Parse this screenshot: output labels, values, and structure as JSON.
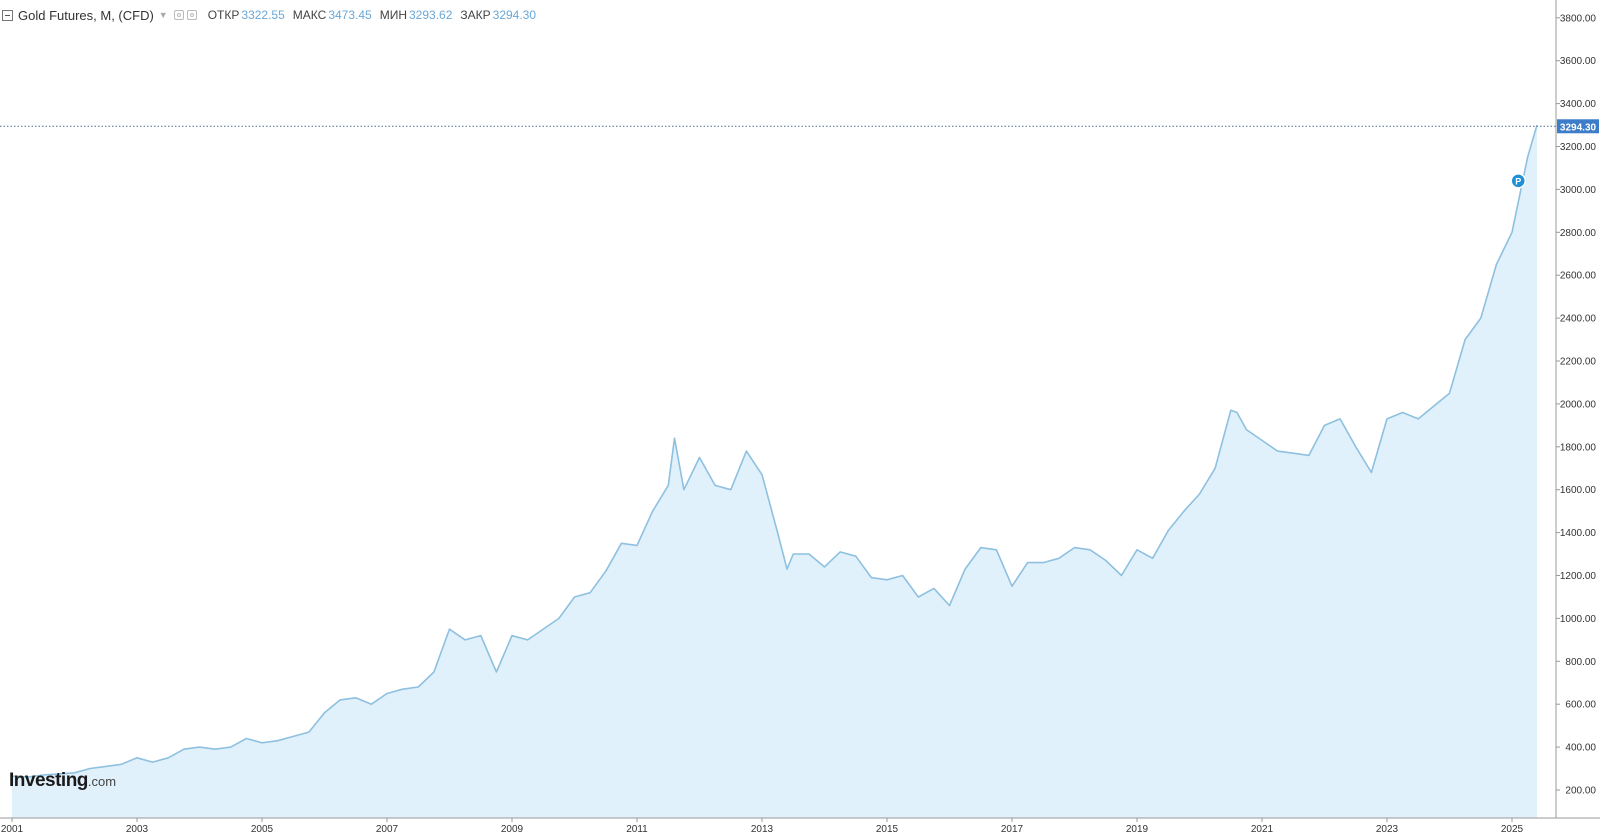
{
  "header": {
    "symbol": "Gold Futures, M, (CFD)",
    "open_label": "ОТКР",
    "open_value": "3322.55",
    "high_label": "МАКС",
    "high_value": "3473.45",
    "low_label": "МИН",
    "low_value": "3293.62",
    "close_label": "ЗАКР",
    "close_value": "3294.30"
  },
  "logo": {
    "brand": "Investing",
    "suffix": ".com"
  },
  "last_price_label": "3294.30",
  "marker_label": "P",
  "colors": {
    "line": "#8ec0e0",
    "area": "#e1f1fb",
    "price_tag": "#3d7cc9",
    "marker": "#1f8fd6"
  },
  "chart_data": {
    "type": "area",
    "title": "Gold Futures, M, (CFD)",
    "xlabel": "",
    "ylabel": "",
    "x_ticks": [
      "2001",
      "2003",
      "2005",
      "2007",
      "2009",
      "2011",
      "2013",
      "2015",
      "2017",
      "2019",
      "2021",
      "2023",
      "2025"
    ],
    "y_ticks": [
      "200.00",
      "400.00",
      "600.00",
      "800.00",
      "1000.00",
      "1200.00",
      "1400.00",
      "1600.00",
      "1800.00",
      "2000.00",
      "2200.00",
      "2400.00",
      "2600.00",
      "2800.00",
      "3000.00",
      "3200.00",
      "3400.00",
      "3600.00",
      "3800.00"
    ],
    "ylim": [
      120,
      3900
    ],
    "xlim": [
      2001.0,
      2025.9
    ],
    "grid": false,
    "last_price": 3294.3,
    "marker": {
      "label": "P",
      "x": 2025.1,
      "y": 3040
    },
    "series": [
      {
        "x": [
          2001.0,
          2001.25,
          2001.5,
          2001.75,
          2002.0,
          2002.25,
          2002.5,
          2002.75,
          2003.0,
          2003.25,
          2003.5,
          2003.75,
          2004.0,
          2004.25,
          2004.5,
          2004.75,
          2005.0,
          2005.25,
          2005.5,
          2005.75,
          2006.0,
          2006.25,
          2006.5,
          2006.75,
          2007.0,
          2007.25,
          2007.5,
          2007.75,
          2008.0,
          2008.25,
          2008.5,
          2008.75,
          2009.0,
          2009.25,
          2009.5,
          2009.75,
          2010.0,
          2010.25,
          2010.5,
          2010.75,
          2011.0,
          2011.25,
          2011.5,
          2011.6,
          2011.75,
          2012.0,
          2012.25,
          2012.5,
          2012.75,
          2013.0,
          2013.25,
          2013.4,
          2013.5,
          2013.75,
          2014.0,
          2014.25,
          2014.5,
          2014.75,
          2015.0,
          2015.25,
          2015.5,
          2015.75,
          2016.0,
          2016.25,
          2016.5,
          2016.75,
          2017.0,
          2017.25,
          2017.5,
          2017.75,
          2018.0,
          2018.25,
          2018.5,
          2018.75,
          2019.0,
          2019.25,
          2019.5,
          2019.75,
          2020.0,
          2020.25,
          2020.5,
          2020.6,
          2020.75,
          2021.0,
          2021.25,
          2021.5,
          2021.75,
          2022.0,
          2022.25,
          2022.5,
          2022.75,
          2023.0,
          2023.25,
          2023.5,
          2023.75,
          2024.0,
          2024.25,
          2024.5,
          2024.75,
          2025.0,
          2025.25,
          2025.4
        ],
        "y": [
          265,
          260,
          270,
          275,
          280,
          300,
          310,
          320,
          350,
          330,
          350,
          390,
          400,
          390,
          400,
          440,
          420,
          430,
          450,
          470,
          560,
          620,
          630,
          600,
          650,
          670,
          680,
          750,
          950,
          900,
          920,
          750,
          920,
          900,
          950,
          1000,
          1100,
          1120,
          1220,
          1350,
          1340,
          1500,
          1620,
          1840,
          1600,
          1750,
          1620,
          1600,
          1780,
          1670,
          1400,
          1230,
          1300,
          1300,
          1240,
          1310,
          1290,
          1190,
          1180,
          1200,
          1100,
          1140,
          1060,
          1230,
          1330,
          1320,
          1150,
          1260,
          1260,
          1280,
          1330,
          1320,
          1270,
          1200,
          1320,
          1280,
          1410,
          1500,
          1580,
          1700,
          1970,
          1960,
          1880,
          1830,
          1780,
          1770,
          1760,
          1900,
          1930,
          1800,
          1680,
          1930,
          1960,
          1930,
          1990,
          2050,
          2300,
          2400,
          2650,
          2800,
          3150,
          3300
        ]
      }
    ]
  }
}
